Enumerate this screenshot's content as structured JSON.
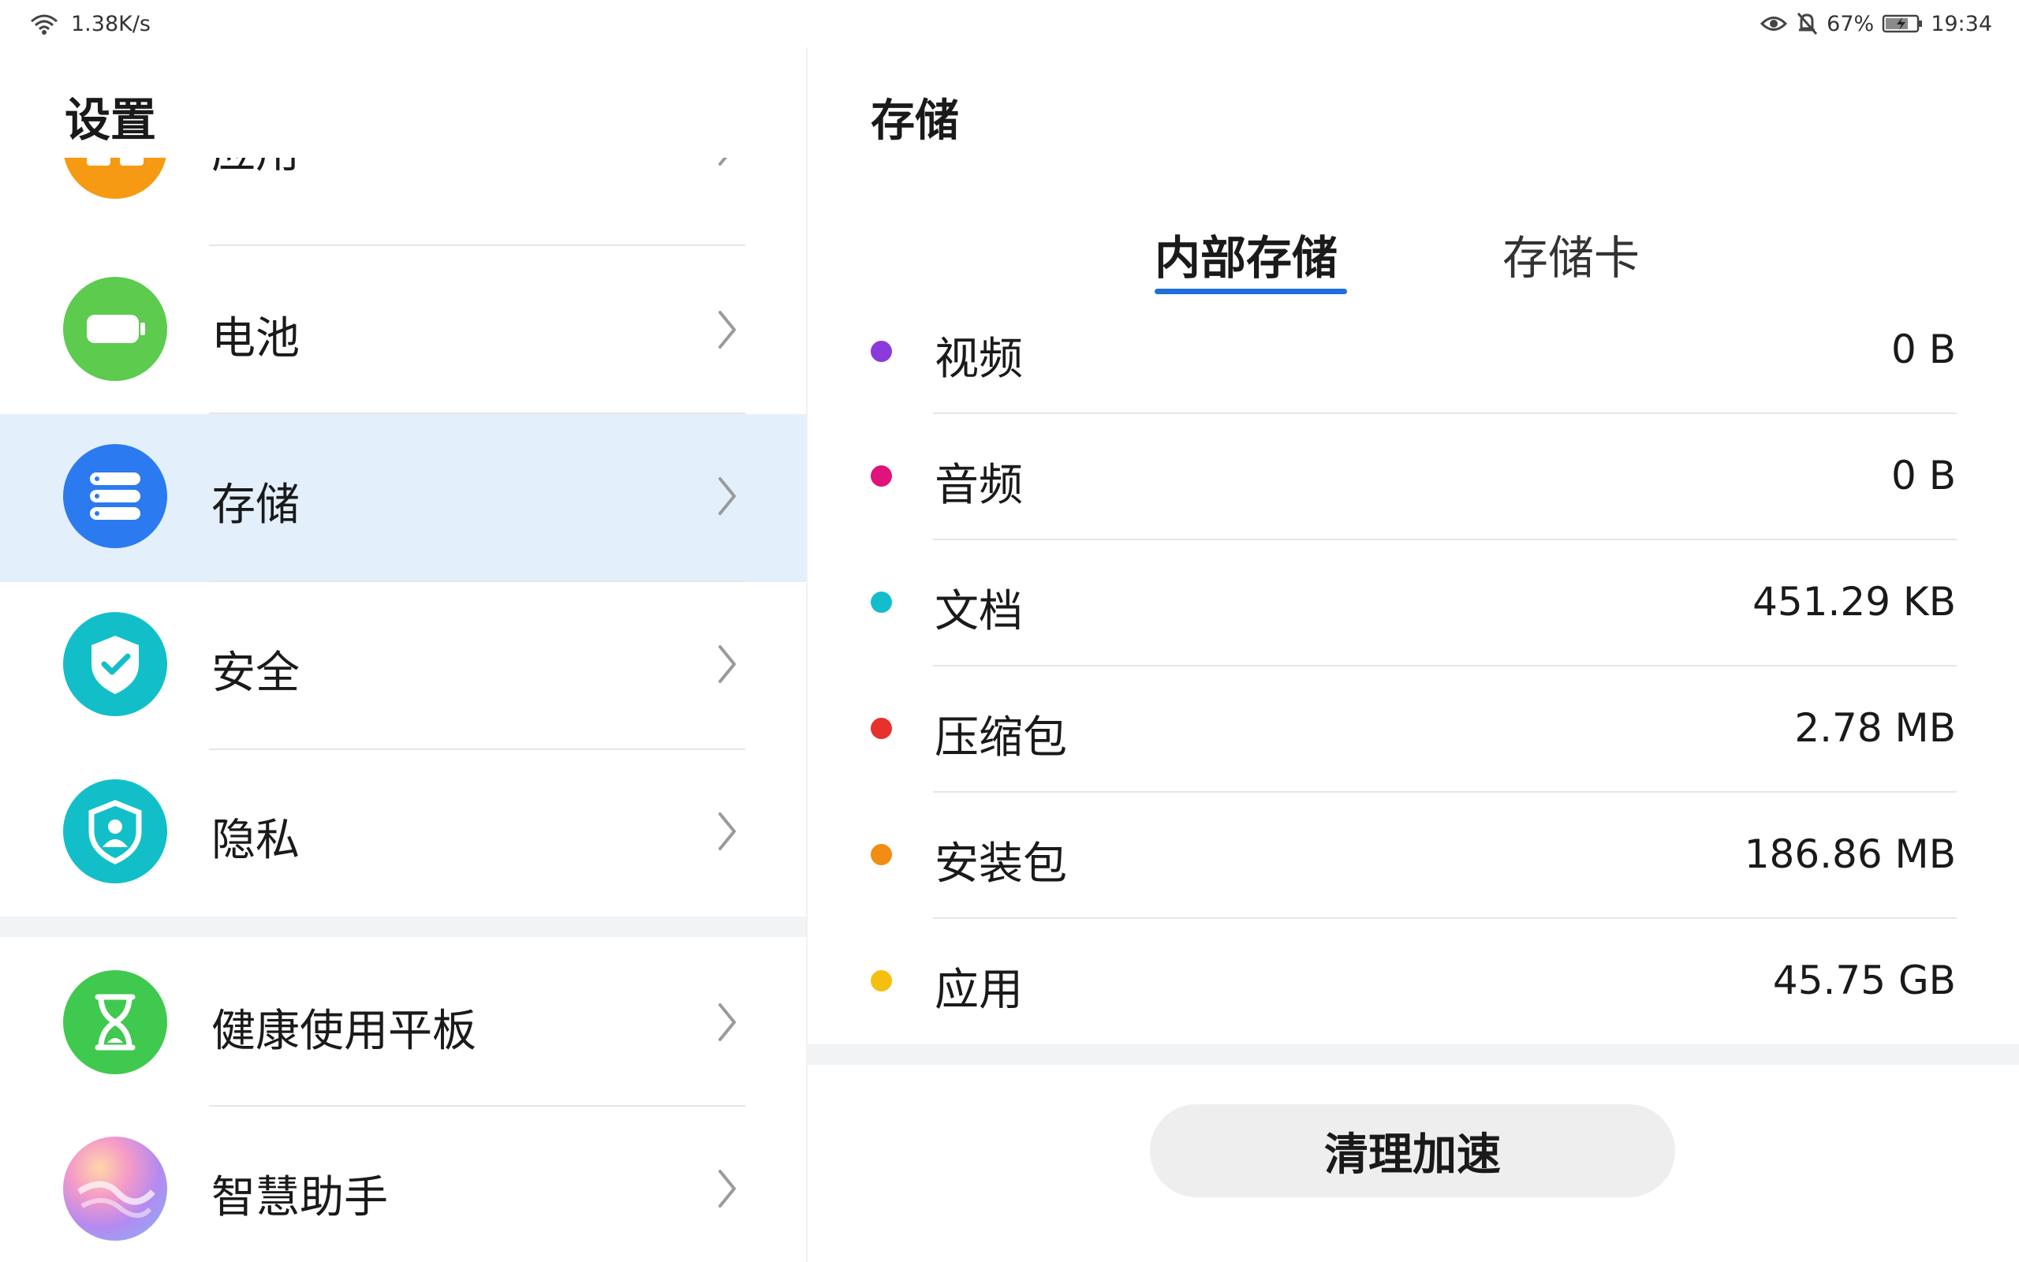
{
  "status_bar": {
    "network_speed": "1.38K/s",
    "battery_percent": "67%",
    "time": "19:34",
    "icons": [
      "wifi-icon",
      "eye-comfort-icon",
      "mute-icon",
      "battery-charging-icon"
    ]
  },
  "settings": {
    "title": "设置",
    "items": [
      {
        "label": "应用",
        "icon": "apps-icon",
        "color": "#f59a12"
      },
      {
        "label": "电池",
        "icon": "battery-icon",
        "color": "#5ccb4e"
      },
      {
        "label": "存储",
        "icon": "storage-icon",
        "color": "#2b7af0",
        "selected": true
      },
      {
        "label": "安全",
        "icon": "shield-check-icon",
        "color": "#12bfc9"
      },
      {
        "label": "隐私",
        "icon": "privacy-icon",
        "color": "#12bfc9"
      },
      {
        "label": "健康使用平板",
        "icon": "hourglass-icon",
        "color": "#3fc94f"
      },
      {
        "label": "智慧助手",
        "icon": "assistant-icon",
        "color": "#c98cf0"
      }
    ]
  },
  "storage": {
    "title": "存储",
    "tabs": [
      {
        "label": "内部存储",
        "active": true
      },
      {
        "label": "存储卡",
        "active": false
      }
    ],
    "categories": [
      {
        "label": "视频",
        "value": "0 B",
        "color": "#8b3bdb"
      },
      {
        "label": "音频",
        "value": "0 B",
        "color": "#e0137a"
      },
      {
        "label": "文档",
        "value": "451.29 KB",
        "color": "#13bdcc"
      },
      {
        "label": "压缩包",
        "value": "2.78 MB",
        "color": "#e8302c"
      },
      {
        "label": "安装包",
        "value": "186.86 MB",
        "color": "#f28c13"
      },
      {
        "label": "应用",
        "value": "45.75 GB",
        "color": "#f5bf10"
      }
    ],
    "clean_button": "清理加速"
  }
}
